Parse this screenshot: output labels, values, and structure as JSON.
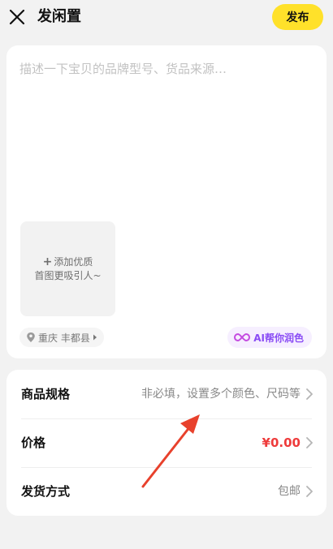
{
  "header": {
    "title": "发闲置",
    "publish_label": "发布"
  },
  "editor": {
    "description_placeholder": "描述一下宝贝的品牌型号、货品来源…",
    "description_value": "",
    "add_photo_line1": "添加优质",
    "add_photo_line2": "首图更吸引人~",
    "location_label": "重庆 丰都县",
    "ai_label": "AI帮你润色"
  },
  "spec": {
    "rows": [
      {
        "label": "商品规格",
        "value": "非必填，设置多个颜色、尺码等"
      },
      {
        "label": "价格",
        "value": "¥0.00"
      },
      {
        "label": "发货方式",
        "value": "包邮"
      }
    ]
  },
  "colors": {
    "accent": "#ffe12a",
    "price": "#ee3b3b",
    "ai": "#8a4cf5",
    "annotation": "#e8412c"
  },
  "icons": [
    "close-icon",
    "plus-icon",
    "location-pin-icon",
    "caret-right-icon",
    "ai-infinity-icon",
    "chevron-right-icon"
  ]
}
